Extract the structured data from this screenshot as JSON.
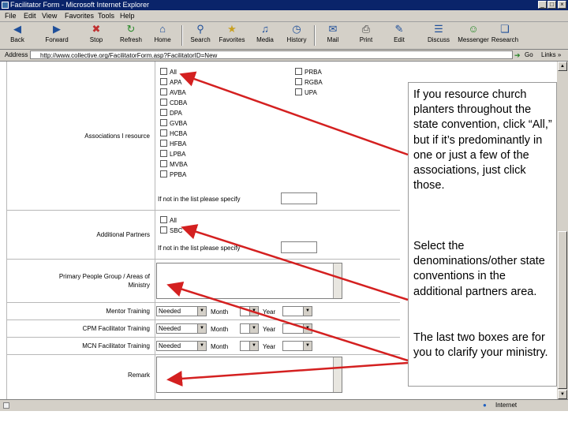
{
  "window": {
    "title": "Facilitator Form - Microsoft Internet Explorer",
    "controls": [
      "_",
      "□",
      "×"
    ]
  },
  "menu": [
    "File",
    "Edit",
    "View",
    "Favorites",
    "Tools",
    "Help"
  ],
  "toolbar": {
    "back": "Back",
    "forward": "Forward",
    "stop": "Stop",
    "refresh": "Refresh",
    "home": "Home",
    "search": "Search",
    "favorites": "Favorites",
    "media": "Media",
    "history": "History",
    "mail": "Mail",
    "print": "Print",
    "edit": "Edit",
    "discuss": "Discuss",
    "messenger": "Messenger",
    "research": "Research"
  },
  "addressbar": {
    "label": "Address",
    "url": "http://www.collective.org/FacilitatorForm.asp?FacilitatorID=New",
    "go": "Go",
    "links": "Links »"
  },
  "form": {
    "associations_label": "Associations I resource",
    "associations_left": [
      "All",
      "APA",
      "AVBA",
      "CDBA",
      "DPA",
      "GVBA",
      "HCBA",
      "HFBA",
      "LPBA",
      "MVBA",
      "PPBA"
    ],
    "associations_right": [
      "PRBA",
      "RGBA",
      "UPA"
    ],
    "not_in_list_label": "If not in the list please specify",
    "additional_partners_label": "Additional Partners",
    "partners_options": [
      "All",
      "SBC"
    ],
    "people_group_label_line1": "Primary People Group / Areas of",
    "people_group_label_line2": "Ministry",
    "mentor_training_label": "Mentor Training",
    "cpm_training_label": "CPM Facilitator Training",
    "mcn_training_label": "MCN Facilitator Training",
    "select_needed": "Needed",
    "month_label": "Month",
    "year_label": "Year",
    "remark_label": "Remark"
  },
  "statusbar": {
    "zone": "Internet"
  },
  "callout": {
    "paragraph1": "If you resource church planters throughout the state convention, click “All,” but if it’s predominantly in one or just a few of the associations, just click those.",
    "paragraph2": "Select the denominations/other state conventions in the additional partners area.",
    "paragraph3": "The last two boxes are for you to clarify your ministry."
  },
  "colors": {
    "arrow": "#d42020",
    "titlebar": "#0a246a",
    "chrome": "#d4d0c8"
  }
}
